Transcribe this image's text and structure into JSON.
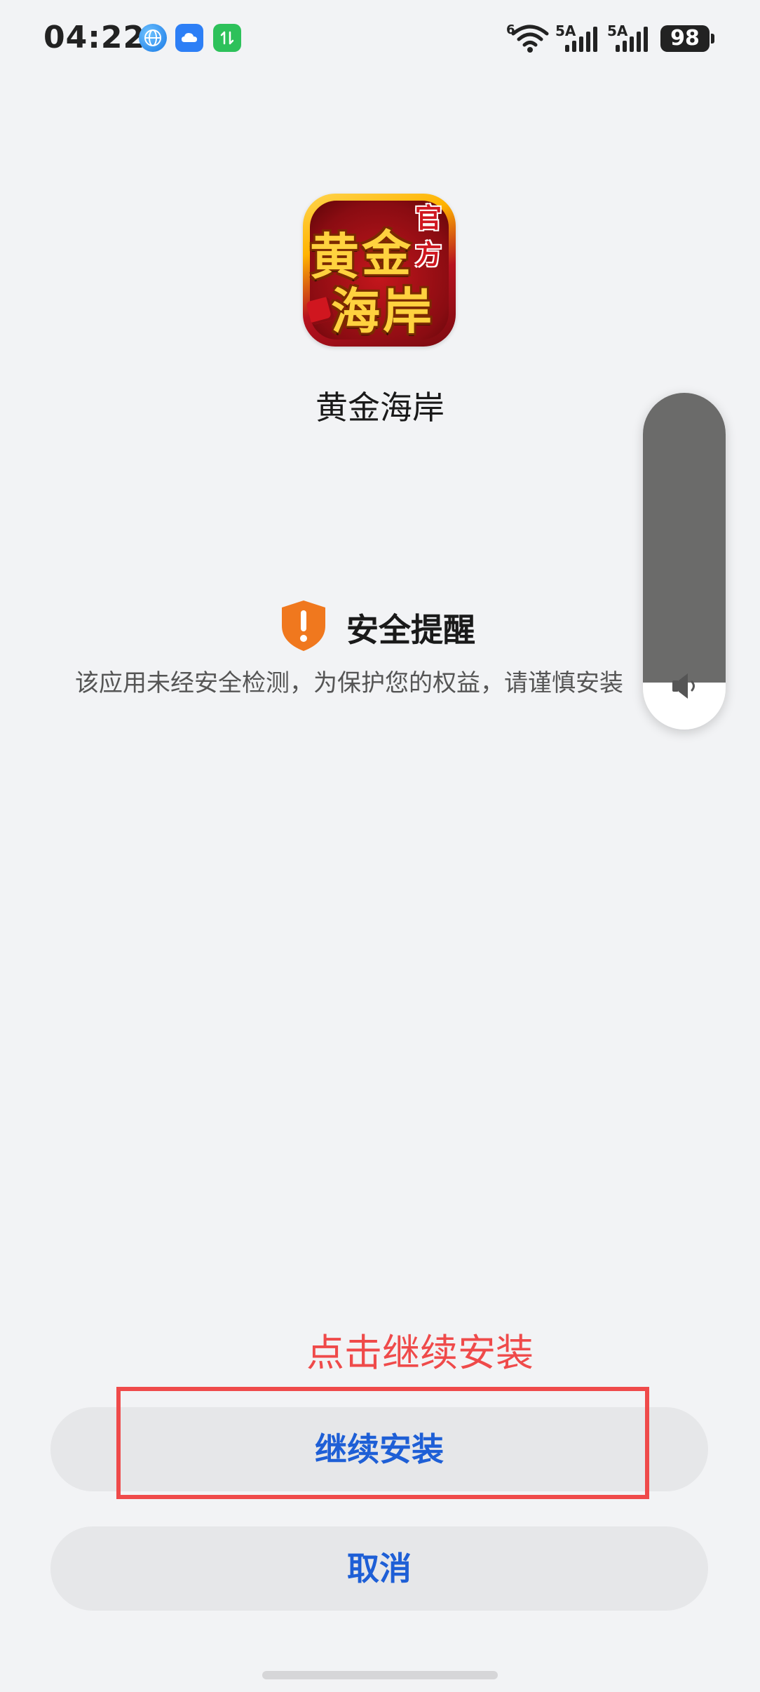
{
  "status_bar": {
    "time": "04:22",
    "network_1": "5A",
    "network_2": "5A",
    "wifi_label": "6",
    "battery": "98",
    "icons": [
      "globe-icon",
      "cloud-icon",
      "transfer-icon",
      "wifi-icon",
      "signal-icon",
      "battery-icon"
    ]
  },
  "app": {
    "name": "黄金海岸",
    "logo_text": [
      "黄",
      "金",
      "海",
      "岸",
      "官",
      "方"
    ]
  },
  "security": {
    "icon": "shield-warning-icon",
    "title": "安全提醒",
    "message": "该应用未经安全检测，为保护您的权益，请谨慎安装"
  },
  "volume": {
    "icon": "speaker-icon",
    "level_fraction": 0.86
  },
  "hint": {
    "text": "点击继续安装",
    "color": "#ef4a4a"
  },
  "buttons": {
    "continue_label": "继续安装",
    "cancel_label": "取消",
    "text_color": "#1e5fd6"
  }
}
